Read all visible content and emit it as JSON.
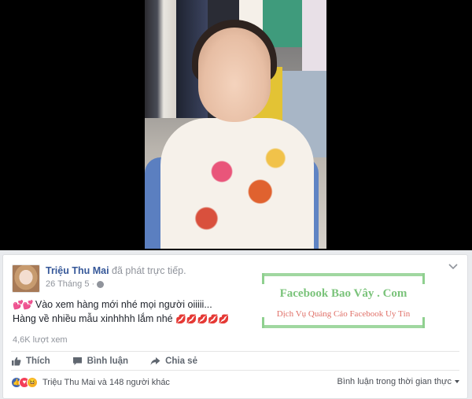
{
  "post": {
    "author_name": "Triệu Thu Mai",
    "author_action": "đã phát trực tiếp.",
    "date": "26 Tháng 5",
    "text_line1": "Vào xem hàng mới nhé mọi người oiiiii...",
    "text_line2": "Hàng về nhiều mẫu xinhhhh lắm nhé",
    "line1_emoji": "💕💕",
    "line2_emoji": "💋💋💋💋💋",
    "views": "4,6K lượt xem"
  },
  "actions": {
    "like_label": "Thích",
    "comment_label": "Bình luận",
    "share_label": "Chia sẻ"
  },
  "reactions": {
    "summary": "Triệu Thu Mai và 148 người khác",
    "types": [
      "like-icon",
      "love-icon",
      "haha-icon"
    ]
  },
  "comments": {
    "sort_label": "Bình luận trong thời gian thực"
  },
  "watermark": {
    "title": "Facebook Bao Vây . Com",
    "subtitle": "Dịch Vụ Quảng Cáo Facebook Uy Tín"
  },
  "colors": {
    "link": "#365899",
    "muted": "#90949c",
    "watermark_green": "#7ac37a",
    "watermark_red": "#e07068"
  }
}
